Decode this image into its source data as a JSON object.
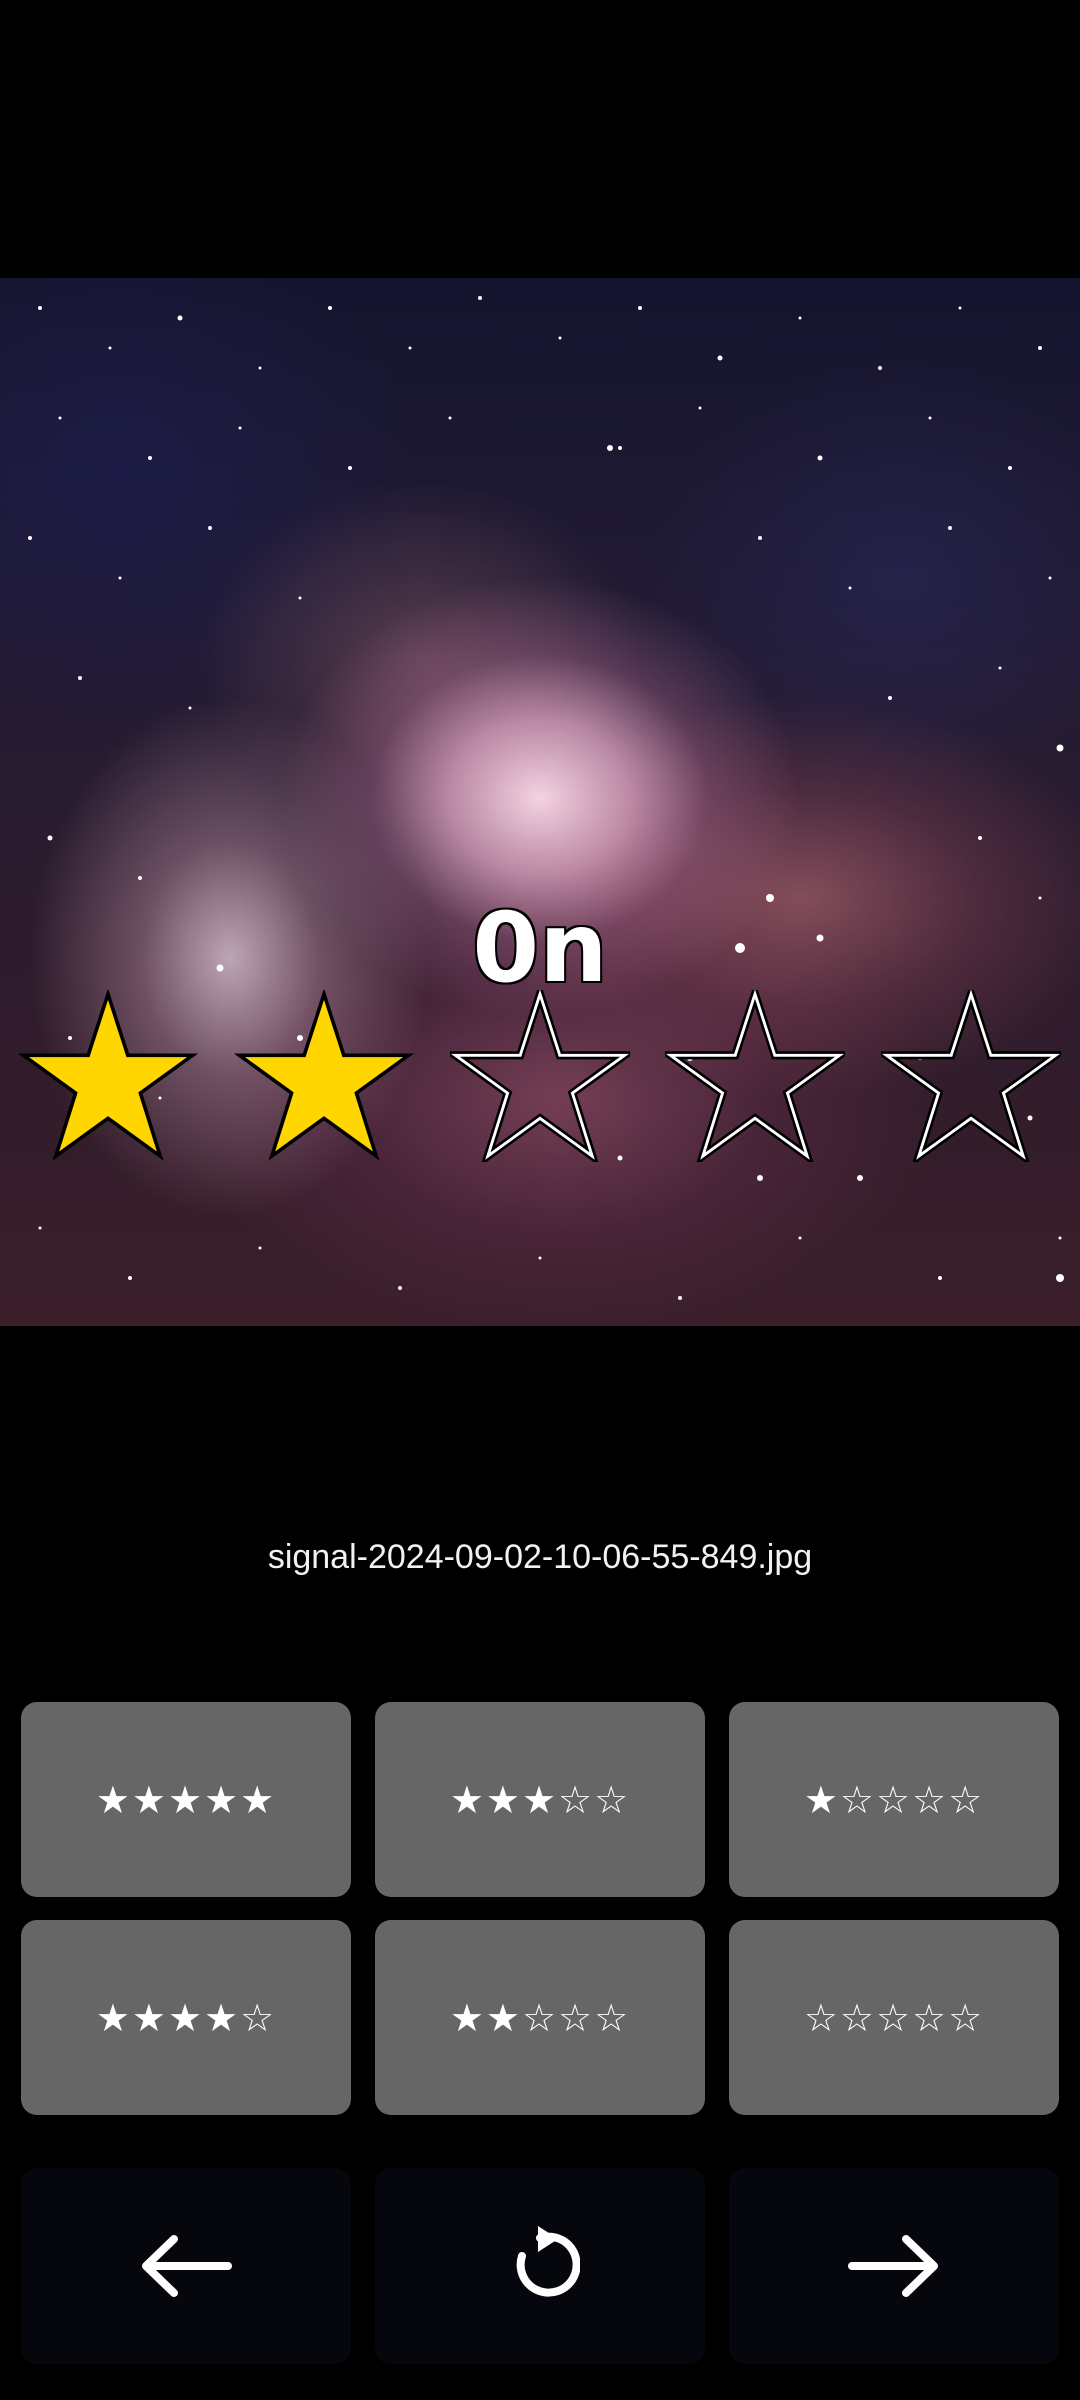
{
  "viewer": {
    "rating_value": 2,
    "rating_max": 5,
    "overlay_label": "0n",
    "file_name": "signal-2024-09-02-10-06-55-849.jpg",
    "photo_subject": "nebula-photo"
  },
  "rating_buttons": [
    {
      "label": "★★★★★"
    },
    {
      "label": "★★★☆☆"
    },
    {
      "label": "★☆☆☆☆"
    },
    {
      "label": "★★★★☆"
    },
    {
      "label": "★★☆☆☆"
    },
    {
      "label": "☆☆☆☆☆"
    }
  ],
  "nav": {
    "previous_icon": "arrow-left-icon",
    "undo_icon": "rotate-ccw-icon",
    "next_icon": "arrow-right-icon"
  },
  "colors": {
    "star_filled": "#FFD600",
    "button_gray": "#666666",
    "nav_button": "#05070D",
    "background": "#000000"
  }
}
